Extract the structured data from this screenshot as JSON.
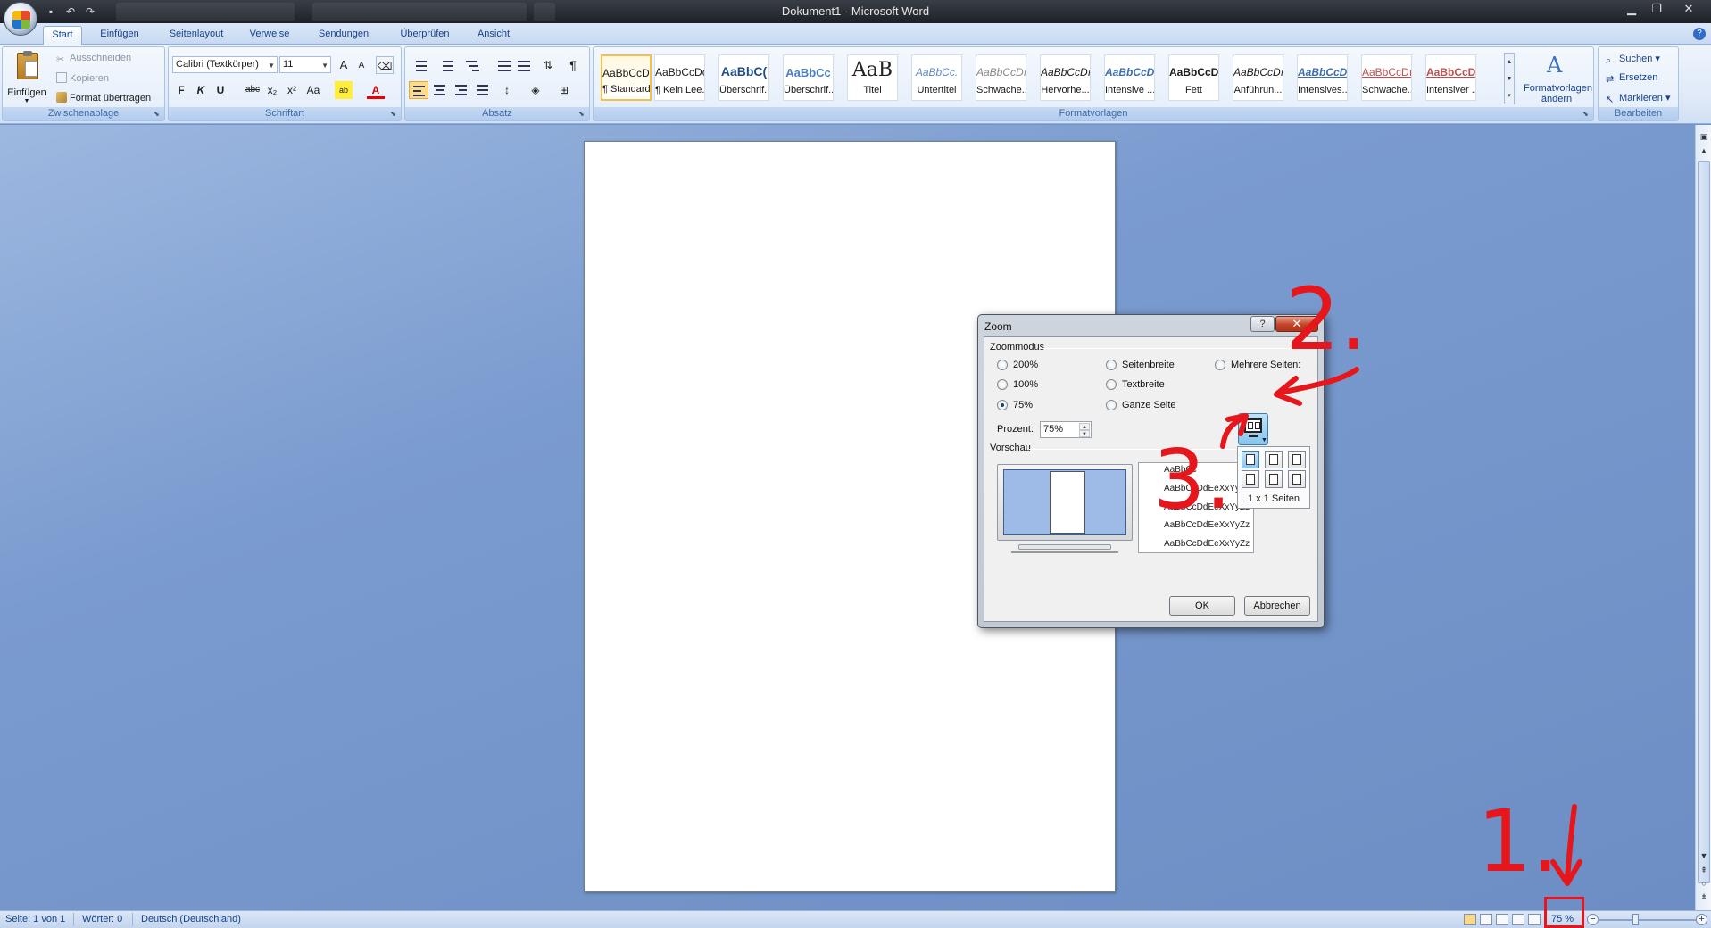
{
  "window": {
    "title": "Dokument1 - Microsoft Word",
    "minimize_icon": "minimize-icon",
    "maximize_icon": "maximize-icon",
    "close_icon": "close-icon"
  },
  "ribbon_tabs": [
    "Start",
    "Einfügen",
    "Seitenlayout",
    "Verweise",
    "Sendungen",
    "Überprüfen",
    "Ansicht"
  ],
  "active_tab": "Start",
  "clipboard": {
    "paste_label": "Einfügen",
    "cut_label": "Ausschneiden",
    "copy_label": "Kopieren",
    "format_painter_label": "Format übertragen",
    "group_label": "Zwischenablage"
  },
  "font": {
    "font_name": "Calibri (Textkörper)",
    "font_size": "11",
    "bold": "F",
    "italic": "K",
    "underline": "U",
    "strike": "abc",
    "subscript": "x₂",
    "superscript": "x²",
    "change_case": "Aa",
    "grow": "A",
    "shrink": "A",
    "font_color_label": "A",
    "group_label": "Schriftart"
  },
  "paragraph": {
    "pilcrow": "¶",
    "group_label": "Absatz"
  },
  "styles": {
    "group_label": "Formatvorlagen",
    "change_styles_label_1": "Formatvorlagen",
    "change_styles_label_2": "ändern",
    "items": [
      {
        "sample": "AaBbCcDc",
        "name": "¶ Standard"
      },
      {
        "sample": "AaBbCcDc",
        "name": "¶ Kein Lee..."
      },
      {
        "sample": "AaBbC(",
        "name": "Überschrif..."
      },
      {
        "sample": "AaBbCc",
        "name": "Überschrif..."
      },
      {
        "sample": "AaB",
        "name": "Titel"
      },
      {
        "sample": "AaBbCc.",
        "name": "Untertitel"
      },
      {
        "sample": "AaBbCcDı",
        "name": "Schwache..."
      },
      {
        "sample": "AaBbCcDı",
        "name": "Hervorhe..."
      },
      {
        "sample": "AaBbCcDı",
        "name": "Intensive ..."
      },
      {
        "sample": "AaBbCcDı",
        "name": "Fett"
      },
      {
        "sample": "AaBbCcDı",
        "name": "Anführun..."
      },
      {
        "sample": "AaBbCcDı",
        "name": "Intensives..."
      },
      {
        "sample": "AaBbCcDı",
        "name": "Schwache..."
      },
      {
        "sample": "AaBbCcDı",
        "name": "Intensiver ..."
      }
    ]
  },
  "editing": {
    "find_label": "Suchen",
    "replace_label": "Ersetzen",
    "select_label": "Markieren",
    "group_label": "Bearbeiten"
  },
  "zoom_dialog": {
    "title": "Zoom",
    "help_label": "?",
    "close_label": "✕",
    "zoom_mode_label": "Zoommodus",
    "options": {
      "p200": "200%",
      "p100": "100%",
      "p75": "75%",
      "page_width": "Seitenbreite",
      "text_width": "Textbreite",
      "whole_page": "Ganze Seite",
      "many_pages": "Mehrere Seiten:"
    },
    "selected_option": "75%",
    "percent_label": "Prozent:",
    "percent_value": "75%",
    "preview_label": "Vorschau",
    "preview_lines": [
      "AaBbCc",
      "AaBbCcDdEeXxYyZz",
      "AaBbCcDdEeXxYyZz",
      "AaBbCcDdEeXxYyZz",
      "AaBbCcDdEeXxYyZz"
    ],
    "pages_caption": "1 x 1 Seiten",
    "ok_label": "OK",
    "cancel_label": "Abbrechen"
  },
  "statusbar": {
    "page": "Seite: 1 von 1",
    "words": "Wörter: 0",
    "language": "Deutsch (Deutschland)",
    "zoom": "75 %",
    "zoom_out": "−",
    "zoom_in": "+"
  },
  "annotations": {
    "step1": "1.",
    "step2": "2.",
    "step3": "3.",
    "color": "#e6171c"
  }
}
